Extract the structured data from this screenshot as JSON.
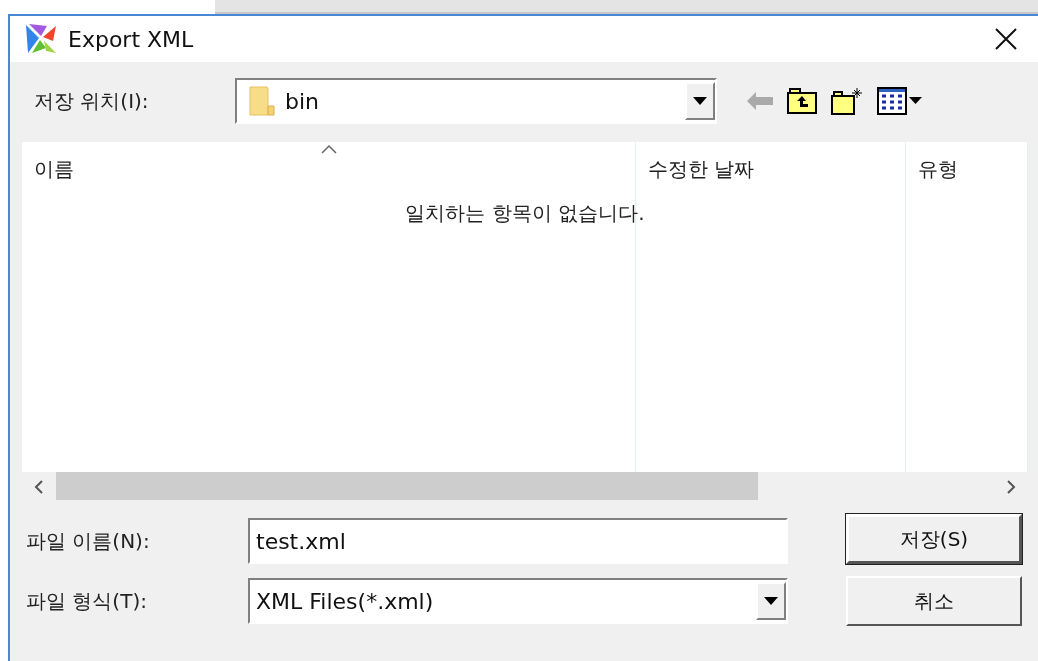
{
  "window": {
    "title": "Export XML"
  },
  "location": {
    "label": "저장 위치(I):",
    "value": "bin"
  },
  "file_list": {
    "columns": [
      {
        "label": "이름",
        "sorted": true
      },
      {
        "label": "수정한 날짜",
        "sorted": false
      },
      {
        "label": "유형",
        "sorted": false
      }
    ],
    "empty_message": "일치하는 항목이 없습니다."
  },
  "file_name": {
    "label": "파일 이름(N):",
    "value": "test.xml"
  },
  "file_type": {
    "label": "파일 형식(T):",
    "value": "XML Files(*.xml)"
  },
  "buttons": [
    {
      "label": "저장(S)",
      "default": true
    },
    {
      "label": "취소",
      "default": false
    }
  ]
}
